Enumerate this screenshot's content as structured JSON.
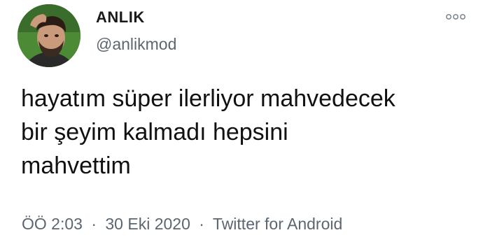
{
  "user": {
    "display_name": "ANLIK",
    "handle": "@anlikmod",
    "avatar_icon": "profile-photo"
  },
  "header": {
    "more_icon": "more-options-icon"
  },
  "tweet": {
    "lines": [
      "hayatım süper ilerliyor mahvedecek",
      "bir şeyim kalmadı hepsini",
      "mahvettim"
    ]
  },
  "meta": {
    "time": "ÖÖ 2:03",
    "separator": "·",
    "date": "30 Eki 2020",
    "client": "Twitter for Android"
  },
  "colors": {
    "text": "#111111",
    "secondary": "#5b6670",
    "background": "#ffffff"
  }
}
